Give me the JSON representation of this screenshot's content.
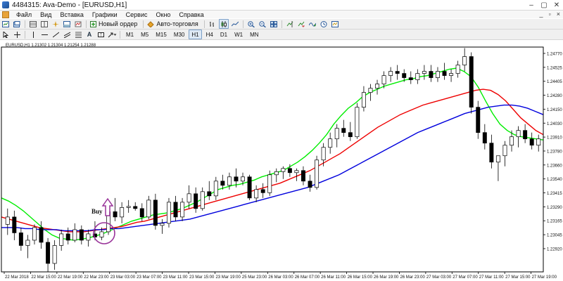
{
  "window": {
    "title": "4484315: Ava-Demo - [EURUSD,H1]",
    "controls": [
      "–",
      "▢",
      "✕"
    ]
  },
  "menu": {
    "items": [
      "Файл",
      "Вид",
      "Вставка",
      "Графики",
      "Сервис",
      "Окно",
      "Справка"
    ],
    "right": [
      "_",
      "▫",
      "×"
    ]
  },
  "toolbar": {
    "new_order": "Новый ордер",
    "auto_trading": "Авто-торговля",
    "timeframes": [
      "M1",
      "M5",
      "M15",
      "M30",
      "H1",
      "H4",
      "D1",
      "W1",
      "MN"
    ]
  },
  "chart": {
    "header": "EURUSD,H1  1.21302 1.21304 1.21254 1.21288",
    "annotation": "Buy",
    "colors": {
      "bull_fill": "#ffffff",
      "bear_fill": "#000000",
      "ma_fast": "#00ee00",
      "ma_mid": "#ee0000",
      "ma_slow": "#0000dd",
      "marker": "#993399",
      "grid": "#e8e8e8"
    }
  },
  "chart_data": {
    "type": "candlestick",
    "symbol": "EURUSD",
    "timeframe": "H1",
    "ylim": [
      1.227,
      1.2483
    ],
    "yticks": [
      "1.24770",
      "1.24525",
      "1.24280",
      "1.24035",
      "1.23790",
      "1.23545",
      "1.23300",
      "1.23055",
      "1.22810"
    ],
    "y_labels": [
      "1.24770",
      "1.24525",
      "1.24405",
      "1.24280",
      "1.24150",
      "1.24030",
      "1.23910",
      "1.23780",
      "1.23660",
      "1.23540",
      "1.23415",
      "1.23290",
      "1.23165",
      "1.23045",
      "1.22920"
    ],
    "x_labels": [
      "22 Mar 2018",
      "22 Mar 15:00",
      "22 Mar 19:00",
      "22 Mar 23:00",
      "23 Mar 03:00",
      "23 Mar 07:00",
      "23 Mar 11:00",
      "23 Mar 15:00",
      "23 Mar 19:00",
      "25 Mar 23:00",
      "26 Mar 03:00",
      "26 Mar 07:00",
      "26 Mar 11:00",
      "26 Mar 15:00",
      "26 Mar 19:00",
      "26 Mar 23:00",
      "27 Mar 03:00",
      "27 Mar 07:00",
      "27 Mar 11:00",
      "27 Mar 15:00",
      "27 Mar 19:00"
    ],
    "candles": [
      [
        1.2315,
        1.233,
        1.2305,
        1.2322
      ],
      [
        1.2322,
        1.2328,
        1.23,
        1.2307
      ],
      [
        1.2307,
        1.2312,
        1.229,
        1.2295
      ],
      [
        1.2295,
        1.2305,
        1.2283,
        1.23
      ],
      [
        1.23,
        1.2315,
        1.2296,
        1.2312
      ],
      [
        1.2312,
        1.2318,
        1.2292,
        1.2298
      ],
      [
        1.2298,
        1.2302,
        1.227,
        1.2278
      ],
      [
        1.2278,
        1.23,
        1.2272,
        1.2295
      ],
      [
        1.2295,
        1.231,
        1.229,
        1.2306
      ],
      [
        1.2306,
        1.2312,
        1.2296,
        1.23
      ],
      [
        1.23,
        1.2316,
        1.2298,
        1.231
      ],
      [
        1.231,
        1.2314,
        1.2296,
        1.23
      ],
      [
        1.23,
        1.231,
        1.2294,
        1.2306
      ],
      [
        1.2306,
        1.2318,
        1.23,
        1.2303
      ],
      [
        1.2303,
        1.2312,
        1.23,
        1.2308
      ],
      [
        1.2308,
        1.233,
        1.2305,
        1.2327
      ],
      [
        1.2327,
        1.234,
        1.2318,
        1.2322
      ],
      [
        1.2322,
        1.2336,
        1.2316,
        1.2331
      ],
      [
        1.2331,
        1.2338,
        1.2326,
        1.2332
      ],
      [
        1.2332,
        1.2336,
        1.2328,
        1.233
      ],
      [
        1.233,
        1.2335,
        1.2318,
        1.2322
      ],
      [
        1.2322,
        1.2342,
        1.232,
        1.2338
      ],
      [
        1.2338,
        1.2344,
        1.231,
        1.2314
      ],
      [
        1.2314,
        1.232,
        1.2306,
        1.2316
      ],
      [
        1.2316,
        1.234,
        1.2312,
        1.2336
      ],
      [
        1.2336,
        1.2342,
        1.2318,
        1.2322
      ],
      [
        1.2322,
        1.234,
        1.2318,
        1.2336
      ],
      [
        1.2336,
        1.2352,
        1.233,
        1.2344
      ],
      [
        1.2344,
        1.235,
        1.2326,
        1.233
      ],
      [
        1.233,
        1.235,
        1.2328,
        1.2346
      ],
      [
        1.2346,
        1.2356,
        1.2338,
        1.2342
      ],
      [
        1.2342,
        1.236,
        1.2338,
        1.2356
      ],
      [
        1.2356,
        1.2362,
        1.2348,
        1.2352
      ],
      [
        1.2352,
        1.2364,
        1.2348,
        1.236
      ],
      [
        1.236,
        1.2368,
        1.235,
        1.2356
      ],
      [
        1.2356,
        1.2364,
        1.2352,
        1.236
      ],
      [
        1.236,
        1.2362,
        1.2338,
        1.234
      ],
      [
        1.234,
        1.2352,
        1.2336,
        1.2348
      ],
      [
        1.2348,
        1.2354,
        1.234,
        1.2345
      ],
      [
        1.2345,
        1.2366,
        1.2342,
        1.2362
      ],
      [
        1.2362,
        1.2368,
        1.2355,
        1.2365
      ],
      [
        1.2365,
        1.237,
        1.2358,
        1.2368
      ],
      [
        1.2368,
        1.2372,
        1.236,
        1.2364
      ],
      [
        1.2364,
        1.2368,
        1.2356,
        1.2366
      ],
      [
        1.2366,
        1.237,
        1.2352,
        1.2356
      ],
      [
        1.2356,
        1.2362,
        1.2346,
        1.235
      ],
      [
        1.235,
        1.238,
        1.2348,
        1.2376
      ],
      [
        1.2376,
        1.2392,
        1.237,
        1.2388
      ],
      [
        1.2388,
        1.2402,
        1.2382,
        1.2396
      ],
      [
        1.2396,
        1.241,
        1.2388,
        1.2406
      ],
      [
        1.2406,
        1.2414,
        1.2398,
        1.2402
      ],
      [
        1.2402,
        1.2412,
        1.2394,
        1.2398
      ],
      [
        1.2398,
        1.243,
        1.2396,
        1.2426
      ],
      [
        1.2426,
        1.2446,
        1.2422,
        1.244
      ],
      [
        1.244,
        1.2448,
        1.2432,
        1.2444
      ],
      [
        1.2444,
        1.2452,
        1.2438,
        1.2448
      ],
      [
        1.2448,
        1.246,
        1.2444,
        1.2456
      ],
      [
        1.2456,
        1.2464,
        1.245,
        1.246
      ],
      [
        1.246,
        1.2466,
        1.2452,
        1.2458
      ],
      [
        1.2458,
        1.2462,
        1.245,
        1.2454
      ],
      [
        1.2454,
        1.246,
        1.2448,
        1.2452
      ],
      [
        1.2452,
        1.2462,
        1.2448,
        1.2458
      ],
      [
        1.2458,
        1.2466,
        1.2452,
        1.246
      ],
      [
        1.246,
        1.2466,
        1.245,
        1.2454
      ],
      [
        1.2454,
        1.2464,
        1.245,
        1.246
      ],
      [
        1.246,
        1.2468,
        1.2452,
        1.2456
      ],
      [
        1.2456,
        1.2462,
        1.245,
        1.2458
      ],
      [
        1.2458,
        1.247,
        1.2454,
        1.2466
      ],
      [
        1.2466,
        1.2482,
        1.246,
        1.2474
      ],
      [
        1.2474,
        1.2478,
        1.242,
        1.2426
      ],
      [
        1.2426,
        1.2432,
        1.2396,
        1.2402
      ],
      [
        1.2402,
        1.241,
        1.2386,
        1.2392
      ],
      [
        1.2392,
        1.24,
        1.2368,
        1.2374
      ],
      [
        1.2374,
        1.238,
        1.2356,
        1.238
      ],
      [
        1.238,
        1.2394,
        1.237,
        1.239
      ],
      [
        1.239,
        1.2404,
        1.2384,
        1.2398
      ],
      [
        1.2398,
        1.2408,
        1.2388,
        1.2404
      ],
      [
        1.2404,
        1.241,
        1.2392,
        1.2396
      ],
      [
        1.2396,
        1.2402,
        1.2386,
        1.239
      ],
      [
        1.239,
        1.24,
        1.2384,
        1.2396
      ]
    ],
    "series": [
      {
        "name": "ma_fast",
        "color": "#00ee00",
        "values": [
          1.234,
          1.2337,
          1.2333,
          1.2328,
          1.2322,
          1.2316,
          1.231,
          1.2305,
          1.2302,
          1.2301,
          1.23,
          1.2301,
          1.2302,
          1.2304,
          1.2306,
          1.2309,
          1.2312,
          1.2315,
          1.2318,
          1.232,
          1.2322,
          1.2324,
          1.2325,
          1.2326,
          1.2328,
          1.233,
          1.2333,
          1.2336,
          1.234,
          1.2344,
          1.2348,
          1.235,
          1.2352,
          1.2353,
          1.2355,
          1.2357,
          1.236,
          1.2362,
          1.2364,
          1.2366,
          1.237,
          1.2374,
          1.2379,
          1.2385,
          1.2392,
          1.24,
          1.241,
          1.2418,
          1.2425,
          1.243,
          1.2436,
          1.244,
          1.2443,
          1.2446,
          1.2448,
          1.245,
          1.2452,
          1.2453,
          1.2455,
          1.2456,
          1.2458,
          1.246,
          1.2462,
          1.2463,
          1.246,
          1.2455,
          1.2445,
          1.2432,
          1.242,
          1.241,
          1.2404,
          1.24,
          1.2398,
          1.2397,
          1.2396,
          1.2395
        ]
      },
      {
        "name": "ma_mid",
        "color": "#ee0000",
        "values": [
          1.2322,
          1.232,
          1.2318,
          1.2316,
          1.2314,
          1.2312,
          1.2311,
          1.231,
          1.2309,
          1.2308,
          1.2308,
          1.2308,
          1.2309,
          1.231,
          1.2311,
          1.2312,
          1.2313,
          1.2315,
          1.2317,
          1.2318,
          1.232,
          1.2322,
          1.2324,
          1.2326,
          1.2328,
          1.233,
          1.2332,
          1.2334,
          1.2336,
          1.2338,
          1.234,
          1.2342,
          1.2344,
          1.2346,
          1.2348,
          1.235,
          1.2352,
          1.2354,
          1.2357,
          1.236,
          1.2363,
          1.2366,
          1.237,
          1.2374,
          1.2378,
          1.2382,
          1.2387,
          1.2392,
          1.2397,
          1.2402,
          1.2407,
          1.2411,
          1.2415,
          1.2419,
          1.2422,
          1.2425,
          1.2428,
          1.243,
          1.2432,
          1.2434,
          1.2436,
          1.2438,
          1.244,
          1.2442,
          1.2443,
          1.2442,
          1.2438,
          1.2432,
          1.2424,
          1.2416,
          1.241,
          1.2404,
          1.24
        ]
      },
      {
        "name": "ma_slow",
        "color": "#0000dd",
        "values": [
          1.2312,
          1.2312,
          1.2312,
          1.2311,
          1.2311,
          1.231,
          1.231,
          1.231,
          1.2309,
          1.2309,
          1.2309,
          1.2309,
          1.231,
          1.231,
          1.2311,
          1.2311,
          1.2312,
          1.2313,
          1.2314,
          1.2315,
          1.2316,
          1.2317,
          1.2318,
          1.2319,
          1.232,
          1.2322,
          1.2324,
          1.2326,
          1.2328,
          1.233,
          1.2332,
          1.2334,
          1.2336,
          1.2338,
          1.234,
          1.2342,
          1.2344,
          1.2346,
          1.2348,
          1.235,
          1.2353,
          1.2356,
          1.2359,
          1.2362,
          1.2366,
          1.237,
          1.2374,
          1.2378,
          1.2382,
          1.2386,
          1.239,
          1.2394,
          1.2398,
          1.2402,
          1.2405,
          1.2408,
          1.2411,
          1.2414,
          1.2417,
          1.242,
          1.2422,
          1.2424,
          1.2426,
          1.2427,
          1.2428,
          1.2428,
          1.2427,
          1.2425,
          1.2422,
          1.2419
        ]
      }
    ]
  }
}
